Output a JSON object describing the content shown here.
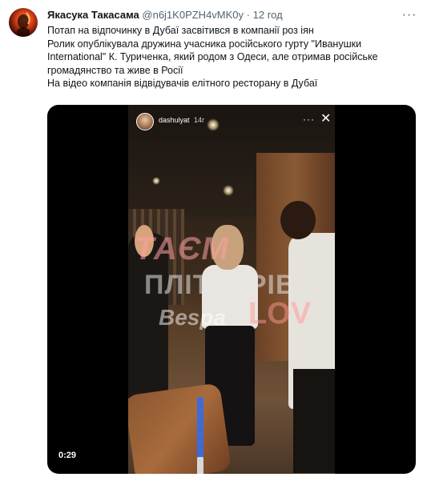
{
  "tweet": {
    "display_name": "Якасука Такасама",
    "handle": "@n6j1K0PZH4vMK0y",
    "separator": "·",
    "time": "12 год",
    "more_label": "···",
    "text_lines": [
      "Потап на відпочинку в Дубаї засвітився в компанії роз іян",
      "Ролик опублікувала дружина учасника російського гурту \"Иванушки International\" К. Туриченка, який родом з Одеси, але отримав російське громадянство та живе в Росії",
      "На відео компанія відвідувачів елітного ресторану в Дубаї"
    ]
  },
  "video": {
    "duration": "0:29",
    "story_user": "dashulyat",
    "story_time": "14г",
    "story_more": "···",
    "story_close": "✕",
    "watermark_top": "ТАЄМ",
    "watermark_middle": "ПЛІТКАРІВ",
    "watermark_brand": "Bespa",
    "watermark_right": "LOV"
  }
}
